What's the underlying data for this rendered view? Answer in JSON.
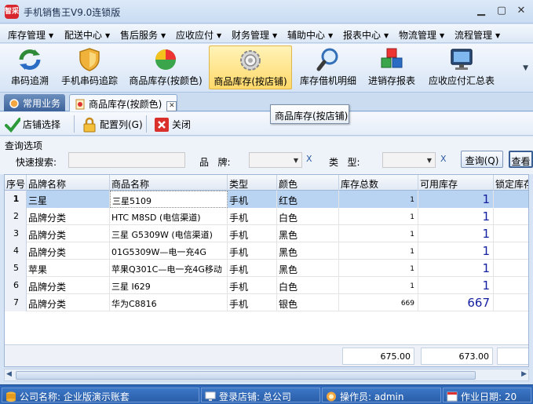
{
  "window": {
    "title": "手机销售王V9.0连锁版",
    "app_icon_text": "智采"
  },
  "menu": [
    {
      "label": "库存管理"
    },
    {
      "label": "配送中心"
    },
    {
      "label": "售后服务"
    },
    {
      "label": "应收应付"
    },
    {
      "label": "财务管理"
    },
    {
      "label": "辅助中心"
    },
    {
      "label": "报表中心"
    },
    {
      "label": "物流管理"
    },
    {
      "label": "流程管理"
    }
  ],
  "toolbar": [
    {
      "label": "串码追溯",
      "icon": "refresh-arrows-icon"
    },
    {
      "label": "手机串码追踪",
      "icon": "shield-icon"
    },
    {
      "label": "商品库存(按颜色)",
      "icon": "color-ball-icon"
    },
    {
      "label": "商品库存(按店铺)",
      "icon": "gear-icon",
      "active": true
    },
    {
      "label": "库存借机明细",
      "icon": "magnifier-icon"
    },
    {
      "label": "进销存报表",
      "icon": "cubes-icon"
    },
    {
      "label": "应收应付汇总表",
      "icon": "monitor-icon"
    }
  ],
  "tabs": [
    {
      "label": "常用业务"
    },
    {
      "label": "商品库存(按颜色)"
    }
  ],
  "commands": {
    "store_select": "店铺选择",
    "config_columns": "配置列(G)",
    "close": "关闭"
  },
  "tooltip": "商品库存(按店铺)",
  "query": {
    "title": "查询选项",
    "quick_search": "快速搜索:",
    "brand": "品   牌:",
    "type": "类   型:",
    "clear": "X",
    "query_button": "查询(Q)",
    "view_button": "查看"
  },
  "grid": {
    "columns": [
      "序号",
      "品牌名称",
      "商品名称",
      "类型",
      "颜色",
      "库存总数",
      "可用库存",
      "锁定库存"
    ],
    "rows": [
      {
        "idx": "1",
        "brand": "三星",
        "name": "三星5109",
        "type": "手机",
        "color": "红色",
        "total": "1",
        "avail": "1"
      },
      {
        "idx": "2",
        "brand": "品牌分类",
        "name": "HTC M8SD (电信渠道)",
        "type": "手机",
        "color": "白色",
        "total": "1",
        "avail": "1"
      },
      {
        "idx": "3",
        "brand": "品牌分类",
        "name": "三星 G5309W (电信渠道)",
        "type": "手机",
        "color": "黑色",
        "total": "1",
        "avail": "1"
      },
      {
        "idx": "4",
        "brand": "品牌分类",
        "name": "01G5309W—电一充4G",
        "type": "手机",
        "color": "黑色",
        "total": "1",
        "avail": "1"
      },
      {
        "idx": "5",
        "brand": "苹果",
        "name": "苹果Q301C—电一充4G移动",
        "type": "手机",
        "color": "黑色",
        "total": "1",
        "avail": "1"
      },
      {
        "idx": "6",
        "brand": "品牌分类",
        "name": "三星 I629",
        "type": "手机",
        "color": "白色",
        "total": "1",
        "avail": "1"
      },
      {
        "idx": "7",
        "brand": "品牌分类",
        "name": "华为C8816",
        "type": "手机",
        "color": "银色",
        "total": "669",
        "avail": "667"
      }
    ],
    "sum_total": "675.00",
    "sum_avail": "673.00"
  },
  "status": {
    "company": "公司名称: 企业版演示账套",
    "store": "登录店铺: 总公司",
    "operator": "操作员: admin",
    "date": "作业日期: 20"
  }
}
